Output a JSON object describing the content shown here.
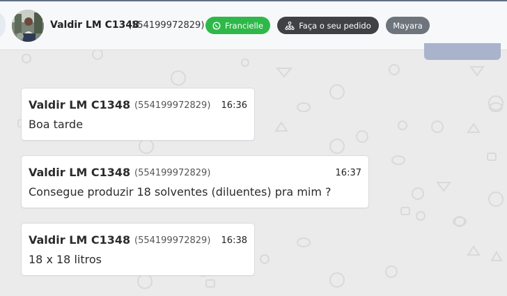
{
  "header": {
    "contact_name": "Valdir LM C1348",
    "contact_phone": "(554199972829)",
    "whatsapp_button_label": "Francielle",
    "order_button_label": "Faça o seu pedido",
    "agent_tag_label": "Mayara"
  },
  "messages": [
    {
      "sender": "Valdir LM C1348",
      "phone": "(554199972829)",
      "time": "16:36",
      "text": "Boa tarde"
    },
    {
      "sender": "Valdir LM C1348",
      "phone": "(554199972829)",
      "time": "16:37",
      "text": "Consegue produzir 18 solventes (diluentes) pra mim ?"
    },
    {
      "sender": "Valdir LM C1348",
      "phone": "(554199972829)",
      "time": "16:38",
      "text": "18 x 18 litros"
    }
  ],
  "colors": {
    "whatsapp_green": "#2eb84a",
    "dark_button": "#3f4145",
    "gray_tag": "#6e747c",
    "chat_background": "#ebebeb"
  },
  "icons": {
    "whatsapp_button": "whatsapp-icon",
    "order_button": "sitemap-icon"
  }
}
